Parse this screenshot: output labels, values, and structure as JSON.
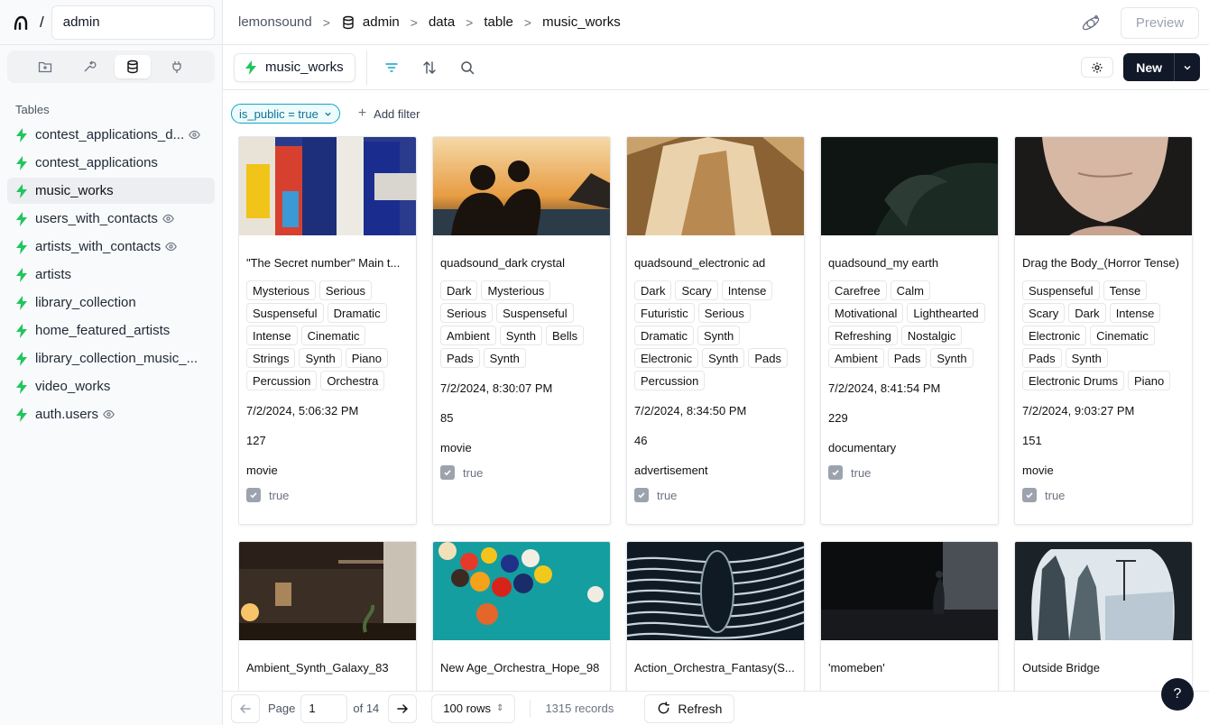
{
  "workspace": {
    "project": "admin",
    "slash": "/"
  },
  "sidebar": {
    "section_title": "Tables",
    "tabs": [
      {
        "icon": "folder-icon"
      },
      {
        "icon": "tools-icon"
      },
      {
        "icon": "database-icon",
        "active": true
      },
      {
        "icon": "plug-icon"
      }
    ],
    "tables": [
      {
        "name": "contest_applications_d...",
        "view": true
      },
      {
        "name": "contest_applications",
        "view": false
      },
      {
        "name": "music_works",
        "view": false,
        "active": true
      },
      {
        "name": "users_with_contacts",
        "view": true
      },
      {
        "name": "artists_with_contacts",
        "view": true
      },
      {
        "name": "artists",
        "view": false
      },
      {
        "name": "library_collection",
        "view": false
      },
      {
        "name": "home_featured_artists",
        "view": false
      },
      {
        "name": "library_collection_music_...",
        "view": false
      },
      {
        "name": "video_works",
        "view": false
      },
      {
        "name": "auth.users",
        "view": true
      }
    ]
  },
  "breadcrumb": {
    "org": "lemonsound",
    "db": "admin",
    "schema": "data",
    "kind": "table",
    "table": "music_works",
    "separator": ">"
  },
  "header": {
    "preview_label": "Preview"
  },
  "toolbar": {
    "tab_label": "music_works",
    "new_label": "New"
  },
  "filters": {
    "active": "is_public = true",
    "add_label": "Add filter"
  },
  "colors": {
    "accent": "#22c55e",
    "filter": "#0ea5c9",
    "primary": "#111827"
  },
  "cards": [
    {
      "title": "\"The Secret number\" Main t...",
      "tags": [
        "Mysterious",
        "Serious",
        "Suspenseful",
        "Dramatic",
        "Intense",
        "Cinematic",
        "Strings",
        "Synth",
        "Piano",
        "Percussion",
        "Orchestra"
      ],
      "date": "7/2/2024, 5:06:32 PM",
      "number": "127",
      "category": "movie",
      "bool": "true"
    },
    {
      "title": "quadsound_dark crystal",
      "tags": [
        "Dark",
        "Mysterious",
        "Serious",
        "Suspenseful",
        "Ambient",
        "Synth",
        "Bells",
        "Pads",
        "Synth"
      ],
      "date": "7/2/2024, 8:30:07 PM",
      "number": "85",
      "category": "movie",
      "bool": "true"
    },
    {
      "title": "quadsound_electronic ad",
      "tags": [
        "Dark",
        "Scary",
        "Intense",
        "Futuristic",
        "Serious",
        "Dramatic",
        "Synth",
        "Electronic",
        "Synth",
        "Pads",
        "Percussion"
      ],
      "date": "7/2/2024, 8:34:50 PM",
      "number": "46",
      "category": "advertisement",
      "bool": "true"
    },
    {
      "title": "quadsound_my earth",
      "tags": [
        "Carefree",
        "Calm",
        "Motivational",
        "Lighthearted",
        "Refreshing",
        "Nostalgic",
        "Ambient",
        "Pads",
        "Synth"
      ],
      "date": "7/2/2024, 8:41:54 PM",
      "number": "229",
      "category": "documentary",
      "bool": "true"
    },
    {
      "title": "Drag the Body_(Horror Tense)",
      "tags": [
        "Suspenseful",
        "Tense",
        "Scary",
        "Dark",
        "Intense",
        "Electronic",
        "Cinematic",
        "Pads",
        "Synth",
        "Electronic Drums",
        "Piano"
      ],
      "date": "7/2/2024, 9:03:27 PM",
      "number": "151",
      "category": "movie",
      "bool": "true"
    },
    {
      "title": "Ambient_Synth_Galaxy_83",
      "tags": [],
      "date": "",
      "number": "",
      "category": "",
      "bool": ""
    },
    {
      "title": "New Age_Orchestra_Hope_98",
      "tags": [],
      "date": "",
      "number": "",
      "category": "",
      "bool": ""
    },
    {
      "title": "Action_Orchestra_Fantasy(S...",
      "tags": [],
      "date": "",
      "number": "",
      "category": "",
      "bool": ""
    },
    {
      "title": "'momeben'",
      "tags": [],
      "date": "",
      "number": "",
      "category": "",
      "bool": ""
    },
    {
      "title": "Outside Bridge",
      "tags": [],
      "date": "",
      "number": "",
      "category": "",
      "bool": ""
    }
  ],
  "pagination": {
    "page_label": "Page",
    "page": "1",
    "of_label": "of 14",
    "rows_label": "100 rows",
    "records": "1315 records",
    "refresh_label": "Refresh"
  },
  "help": {
    "label": "?"
  }
}
